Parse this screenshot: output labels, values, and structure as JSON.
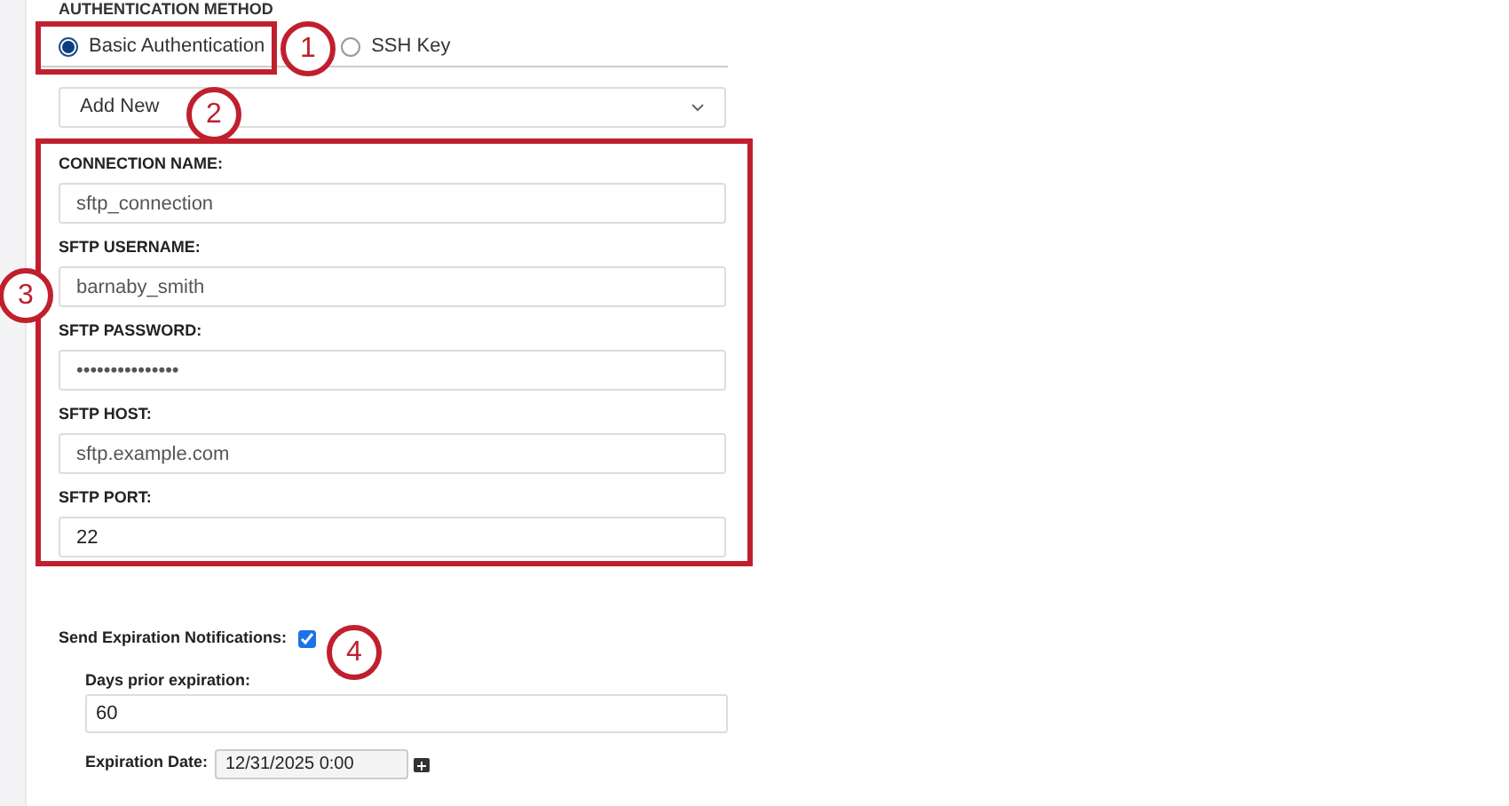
{
  "auth_method": {
    "heading": "AUTHENTICATION METHOD",
    "options": [
      {
        "label": "Basic Authentication",
        "selected": true,
        "highlighted": true
      },
      {
        "label": "SSH Key",
        "selected": false,
        "highlighted": false
      }
    ]
  },
  "connection_select": {
    "value": "Add New"
  },
  "connection_fields": [
    {
      "label": "CONNECTION NAME:",
      "value": "sftp_connection"
    },
    {
      "label": "SFTP USERNAME:",
      "value": "barnaby_smith"
    },
    {
      "label": "SFTP PASSWORD:",
      "value": "•••••••••••••••"
    },
    {
      "label": "SFTP HOST:",
      "value": "sftp.example.com"
    },
    {
      "label": "SFTP PORT:",
      "value": "22"
    }
  ],
  "expiration": {
    "label": "Send Expiration Notifications:",
    "checked": true,
    "days_label": "Days prior expiration:",
    "days_value": "60",
    "date_label": "Expiration Date:",
    "date_value": "12/31/2025 0:00"
  },
  "callouts": [
    {
      "number": "1"
    },
    {
      "number": "2"
    },
    {
      "number": "3"
    },
    {
      "number": "4"
    }
  ]
}
